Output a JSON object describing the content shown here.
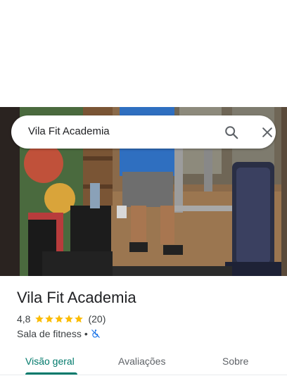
{
  "search": {
    "query": "Vila Fit Academia"
  },
  "place": {
    "name": "Vila Fit Academia",
    "rating": "4,8",
    "stars": 5,
    "reviews": "(20)",
    "category": "Sala de fitness",
    "separator": "•"
  },
  "tabs": [
    {
      "label": "Visão geral",
      "active": true
    },
    {
      "label": "Avaliações",
      "active": false
    },
    {
      "label": "Sobre",
      "active": false
    }
  ],
  "colors": {
    "accent": "#00796b",
    "star": "#fbbc04",
    "access_icon": "#1a73e8"
  },
  "icons": {
    "search": "search-icon",
    "close": "close-icon",
    "accessibility": "wheelchair-crossed-icon"
  }
}
